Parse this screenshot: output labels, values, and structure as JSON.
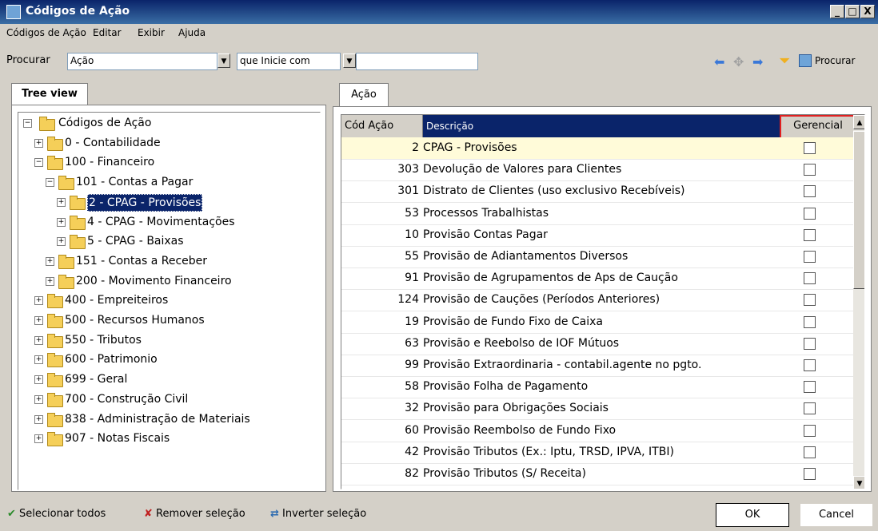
{
  "window": {
    "title": "Códigos de Ação",
    "controls": {
      "minimize": "_",
      "maximize": "□",
      "close": "X"
    }
  },
  "menu": {
    "items": [
      {
        "label": "Códigos de Ação"
      },
      {
        "label": "Editar"
      },
      {
        "label": "Exibir"
      },
      {
        "label": "Ajuda"
      }
    ]
  },
  "search": {
    "label": "Procurar",
    "field_value": "Ação",
    "operator_value": "que Inicie com",
    "query_value": "",
    "find_button": "Procurar"
  },
  "tree": {
    "tab_label": "Tree view",
    "items": [
      {
        "label": "Códigos de Ação",
        "expander": "−"
      },
      {
        "label": "0 - Contabilidade",
        "expander": "+"
      },
      {
        "label": "100 - Financeiro",
        "expander": "−"
      },
      {
        "label": "101 - Contas a Pagar",
        "expander": "−"
      },
      {
        "label": "2 - CPAG - Provisões",
        "expander": "+"
      },
      {
        "label": "4 - CPAG - Movimentações",
        "expander": "+"
      },
      {
        "label": "5 - CPAG - Baixas",
        "expander": "+"
      },
      {
        "label": "151 - Contas a Receber",
        "expander": "+"
      },
      {
        "label": "200 - Movimento Financeiro",
        "expander": "+"
      },
      {
        "label": "400 - Empreiteiros",
        "expander": "+"
      },
      {
        "label": "500 - Recursos Humanos",
        "expander": "+"
      },
      {
        "label": "550 - Tributos",
        "expander": "+"
      },
      {
        "label": "600 - Patrimonio",
        "expander": "+"
      },
      {
        "label": "699 - Geral",
        "expander": "+"
      },
      {
        "label": "700 - Construção Civil",
        "expander": "+"
      },
      {
        "label": "838 - Administração de Materiais",
        "expander": "+"
      },
      {
        "label": "907 - Notas Fiscais",
        "expander": "+"
      }
    ]
  },
  "grid": {
    "tab_label": "Ação",
    "headers": {
      "code": "Cód Ação",
      "description": "Descrição",
      "managerial": "Gerencial"
    },
    "rows": [
      {
        "code": "2",
        "description": "CPAG - Provisões"
      },
      {
        "code": "303",
        "description": "Devolução de Valores para Clientes"
      },
      {
        "code": "301",
        "description": "Distrato de Clientes (uso exclusivo Recebíveis)"
      },
      {
        "code": "53",
        "description": "Processos Trabalhistas"
      },
      {
        "code": "10",
        "description": "Provisão Contas Pagar"
      },
      {
        "code": "55",
        "description": "Provisão de Adiantamentos Diversos"
      },
      {
        "code": "91",
        "description": "Provisão de Agrupamentos de Aps de Caução"
      },
      {
        "code": "124",
        "description": "Provisão de Cauções (Períodos Anteriores)"
      },
      {
        "code": "19",
        "description": "Provisão de Fundo Fixo de Caixa"
      },
      {
        "code": "63",
        "description": "Provisão e Reebolso de IOF Mútuos"
      },
      {
        "code": "99",
        "description": "Provisão Extraordinaria - contabil.agente no pgto."
      },
      {
        "code": "58",
        "description": "Provisão Folha de Pagamento"
      },
      {
        "code": "32",
        "description": "Provisão para Obrigações Sociais"
      },
      {
        "code": "60",
        "description": "Provisão Reembolso de Fundo Fixo"
      },
      {
        "code": "42",
        "description": "Provisão Tributos (Ex.: Iptu, TRSD, IPVA, ITBI)"
      },
      {
        "code": "82",
        "description": "Provisão Tributos (S/ Receita)"
      }
    ]
  },
  "footer": {
    "select_all": "Selecionar todos",
    "remove_selection": "Remover seleção",
    "invert_selection": "Inverter seleção",
    "ok": "OK",
    "cancel": "Cancel"
  },
  "colors": {
    "title_bar": "#0a246a",
    "grid_header": "#0a246a",
    "highlight_border": "#e02020",
    "selected_row": "#fffbd9"
  }
}
